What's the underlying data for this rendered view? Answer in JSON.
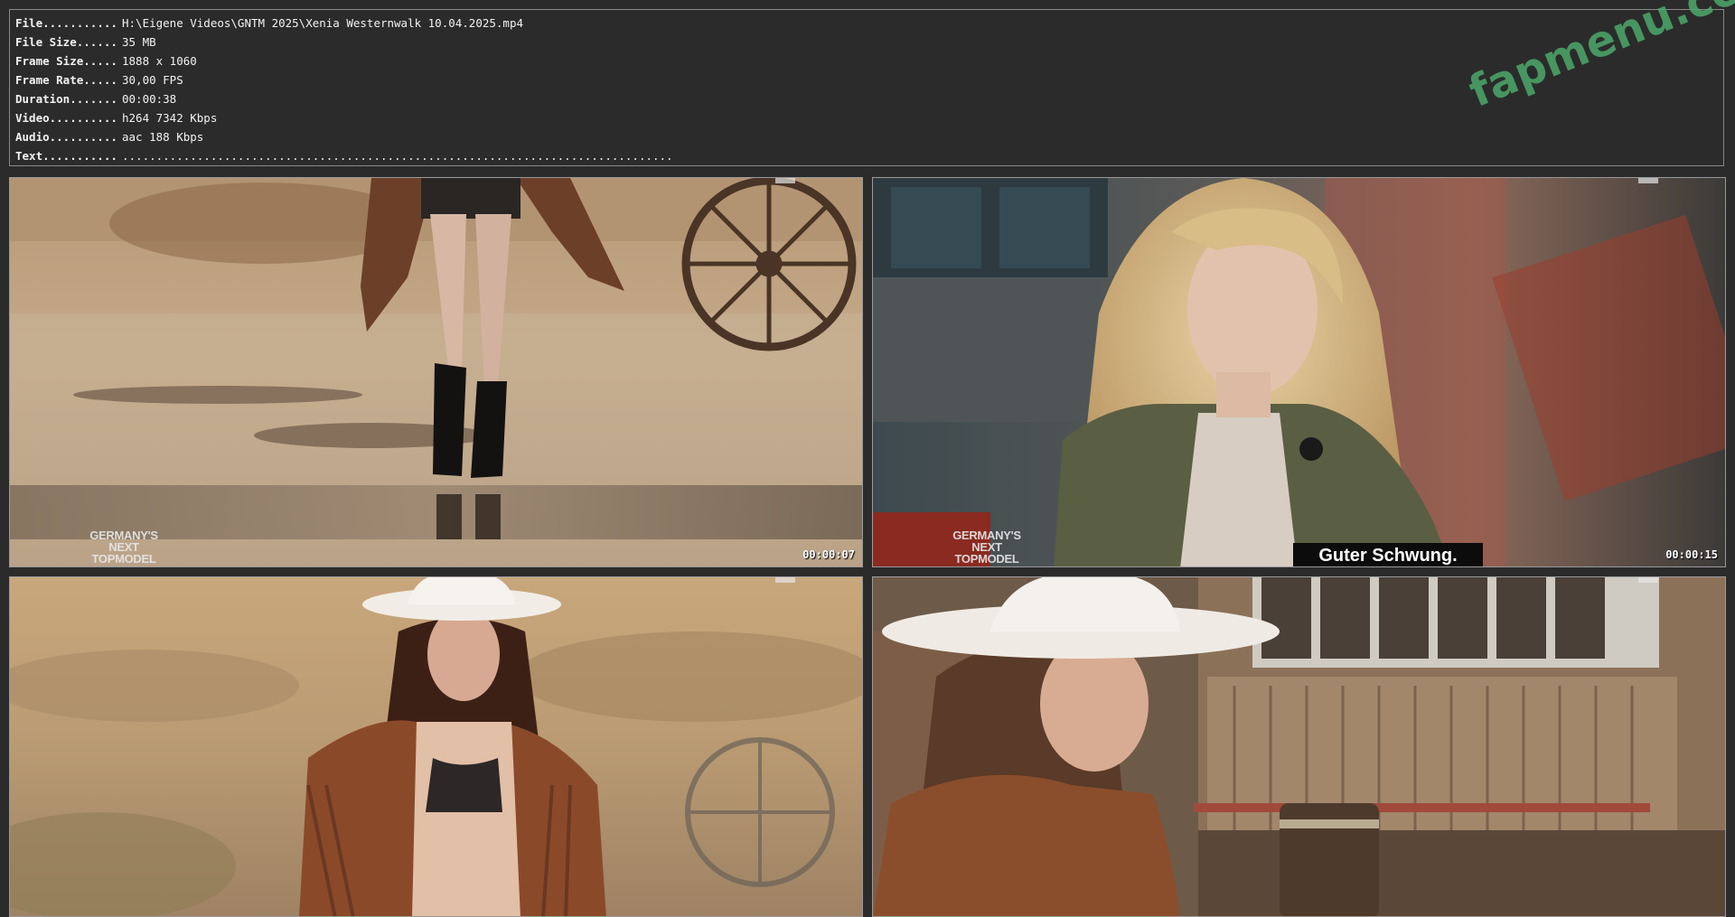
{
  "info": {
    "rows": [
      {
        "key": "File...........",
        "value": "H:\\Eigene Videos\\GNTM 2025\\Xenia Westernwalk 10.04.2025.mp4"
      },
      {
        "key": "File Size......",
        "value": "35 MB"
      },
      {
        "key": "Frame Size.....",
        "value": "1888 x 1060"
      },
      {
        "key": "Frame Rate.....",
        "value": "30,00 FPS"
      },
      {
        "key": "Duration.......",
        "value": "00:00:38"
      },
      {
        "key": "Video..........",
        "value": "h264 7342 Kbps"
      },
      {
        "key": "Audio..........",
        "value": "aac 188 Kbps"
      },
      {
        "key": "Text...........",
        "value": "................................................................................."
      }
    ]
  },
  "thumbnails": [
    {
      "timestamp": "00:00:07",
      "logo": "GERMANY'S NEXT TOPMODEL",
      "subtitle": ""
    },
    {
      "timestamp": "00:00:15",
      "logo": "GERMANY'S NEXT TOPMODEL",
      "subtitle": "Guter Schwung."
    },
    {
      "timestamp": "",
      "logo": "",
      "subtitle": ""
    },
    {
      "timestamp": "",
      "logo": "",
      "subtitle": ""
    }
  ],
  "watermark": "fapmenu.com",
  "colors": {
    "background": "#2b2b2b",
    "info_text": "#f2f2f2",
    "watermark": "#4da86a"
  }
}
